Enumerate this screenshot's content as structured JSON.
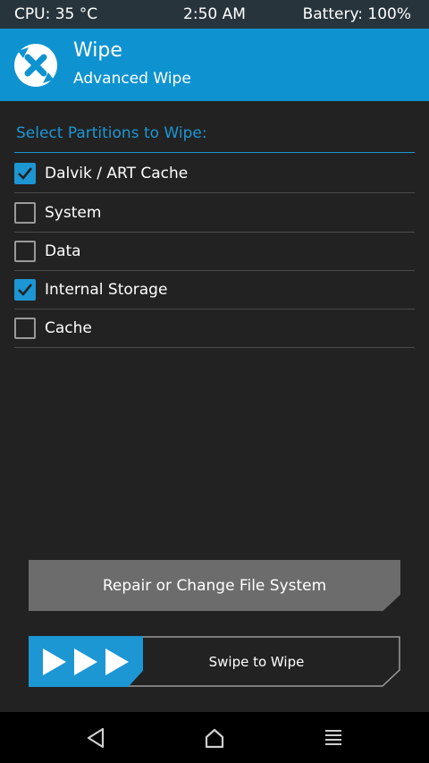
{
  "status_bar": {
    "cpu": "CPU: 35 °C",
    "time": "2:50 AM",
    "battery": "Battery: 100%"
  },
  "header": {
    "title": "Wipe",
    "subtitle": "Advanced Wipe",
    "logo_icon": "twrp-logo-icon"
  },
  "partitions": {
    "title": "Select Partitions to Wipe:",
    "items": [
      {
        "label": "Dalvik / ART Cache",
        "checked": true
      },
      {
        "label": "System",
        "checked": false
      },
      {
        "label": "Data",
        "checked": false
      },
      {
        "label": "Internal Storage",
        "checked": true
      },
      {
        "label": "Cache",
        "checked": false
      }
    ]
  },
  "buttons": {
    "repair_label": "Repair or Change File System"
  },
  "swipe": {
    "label": "Swipe to Wipe",
    "handle_icon": "triple-arrow-icon"
  },
  "navbar": {
    "icons": [
      "back-icon",
      "home-icon",
      "menu-icon"
    ]
  },
  "colors": {
    "accent": "#1d96d4",
    "header": "#0f93d0",
    "background": "#222222",
    "status_bar": "#27343c"
  }
}
